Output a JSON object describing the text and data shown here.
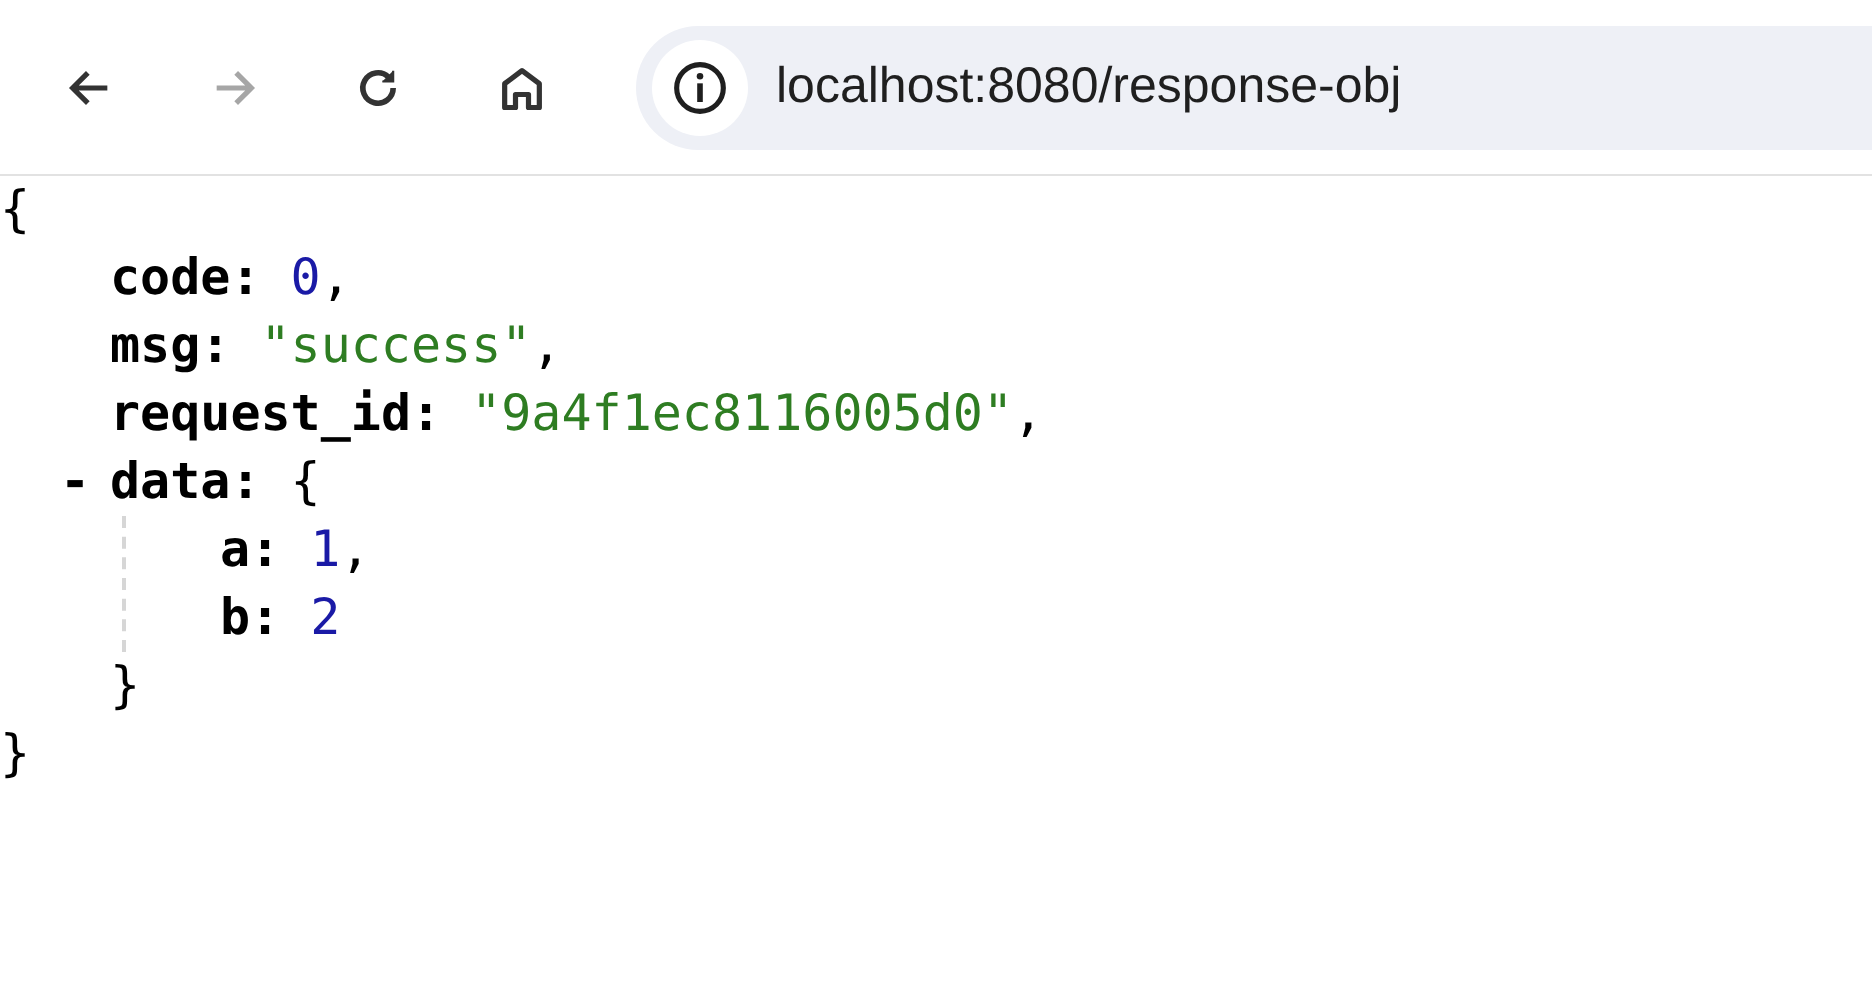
{
  "toolbar": {
    "buttons": [
      {
        "kind": "back",
        "disabled": false
      },
      {
        "kind": "forward",
        "disabled": true
      },
      {
        "kind": "reload",
        "disabled": false
      },
      {
        "kind": "home",
        "disabled": false
      }
    ],
    "address": "localhost:8080/response-obj"
  },
  "viewer": {
    "open_brace": "{",
    "close_brace": "}",
    "entries": [
      {
        "key": "code:",
        "kind": "number",
        "value": "0",
        "separator": ","
      },
      {
        "key": "msg:",
        "kind": "string",
        "value": "\"success\"",
        "separator": ","
      },
      {
        "key": "request_id:",
        "kind": "string",
        "value": "\"9a4f1ec8116005d0\"",
        "separator": ","
      },
      {
        "key": "data:",
        "kind": "object",
        "toggle": "-",
        "expanded": true,
        "open_brace": "{",
        "close_brace": "}",
        "children": [
          {
            "key": "a:",
            "kind": "number",
            "value": "1",
            "separator": ","
          },
          {
            "key": "b:",
            "kind": "number",
            "value": "2"
          }
        ]
      }
    ]
  }
}
